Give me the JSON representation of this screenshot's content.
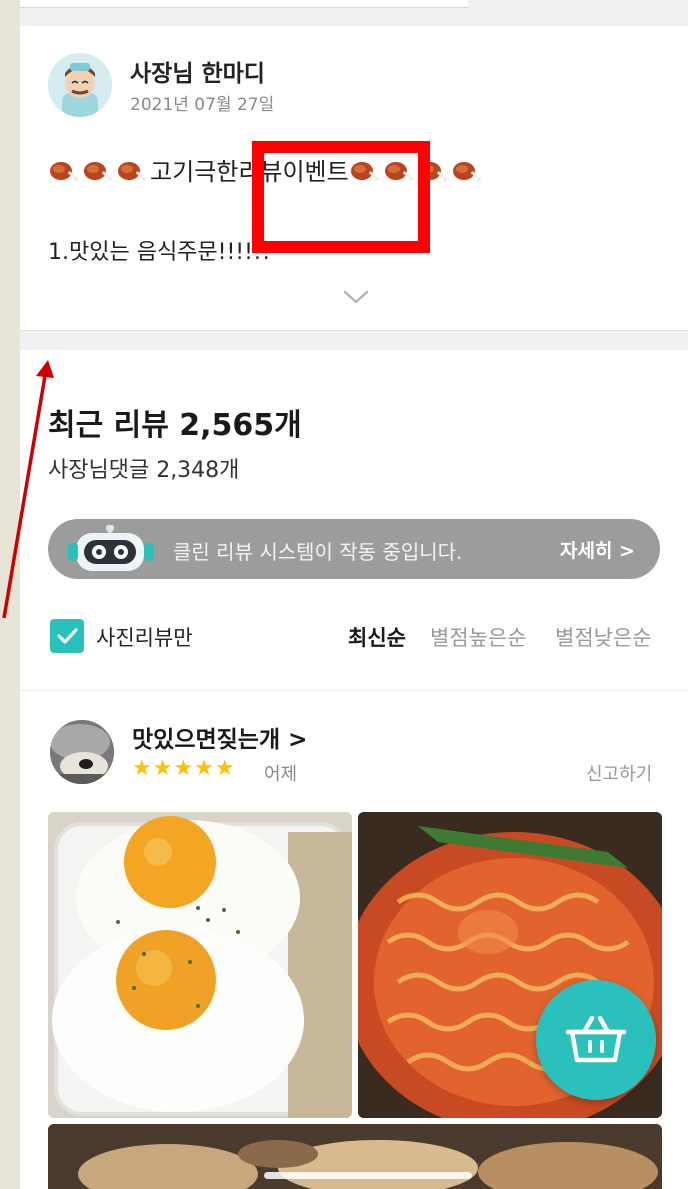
{
  "notice": {
    "owner_name": "사장님 한마디",
    "date": "2021년 07월 27일",
    "event_title": "고기극한리뷰이벤트",
    "line2": "1.맛있는 음식주문!!!!!!",
    "expand_icon": "chevron-down-icon"
  },
  "reviews": {
    "title": "최근 리뷰 2,565개",
    "owner_comments": "사장님댓글 2,348개",
    "clean_banner": {
      "text": "클린 리뷰 시스템이 작동 중입니다.",
      "more": "자세히 >"
    },
    "photo_only_label": "사진리뷰만",
    "photo_only_checked": true,
    "sort_options": [
      "최신순",
      "별점높은순",
      "별점낮은순"
    ],
    "selected_sort": "최신순"
  },
  "review": {
    "reviewer": "맛있으면짖는개 >",
    "stars": "★★★★★",
    "rating": 5,
    "date": "어제",
    "report": "신고하기"
  },
  "colors": {
    "accent": "#2ac1bc",
    "star": "#ffc107",
    "highlight": "#ff0000",
    "annotation_arrow": "#cc0000"
  },
  "icons": [
    "meat-on-bone-icon",
    "chevron-down-icon",
    "robot-icon",
    "check-icon",
    "shopping-basket-icon"
  ]
}
